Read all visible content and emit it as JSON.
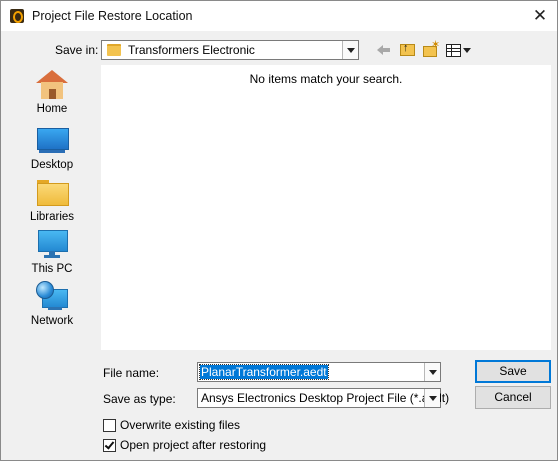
{
  "window": {
    "title": "Project File Restore Location",
    "close_glyph": "✕"
  },
  "toolbar": {
    "save_in_label": "Save in:",
    "save_in_value": "Transformers Electronic",
    "icons": [
      "back-arrow-icon",
      "up-folder-icon",
      "new-folder-icon",
      "view-menu-icon"
    ]
  },
  "places": [
    {
      "label": "Home",
      "icon": "home-icon"
    },
    {
      "label": "Desktop",
      "icon": "desktop-icon"
    },
    {
      "label": "Libraries",
      "icon": "libraries-icon"
    },
    {
      "label": "This PC",
      "icon": "this-pc-icon"
    },
    {
      "label": "Network",
      "icon": "network-icon"
    }
  ],
  "file_list": {
    "empty_message": "No items match your search."
  },
  "form": {
    "file_name_label": "File name:",
    "file_name_value": "PlanarTransformer.aedt",
    "save_type_label": "Save as type:",
    "save_type_value": "Ansys Electronics Desktop Project File (*.aedt)"
  },
  "buttons": {
    "save": "Save",
    "cancel": "Cancel"
  },
  "options": {
    "overwrite_label": "Overwrite existing files",
    "overwrite_checked": false,
    "open_after_label": "Open project after restoring",
    "open_after_checked": true
  },
  "colors": {
    "selection": "#0078d7",
    "default_button_border": "#0078d7",
    "dialog_background": "#f0f0f0"
  }
}
